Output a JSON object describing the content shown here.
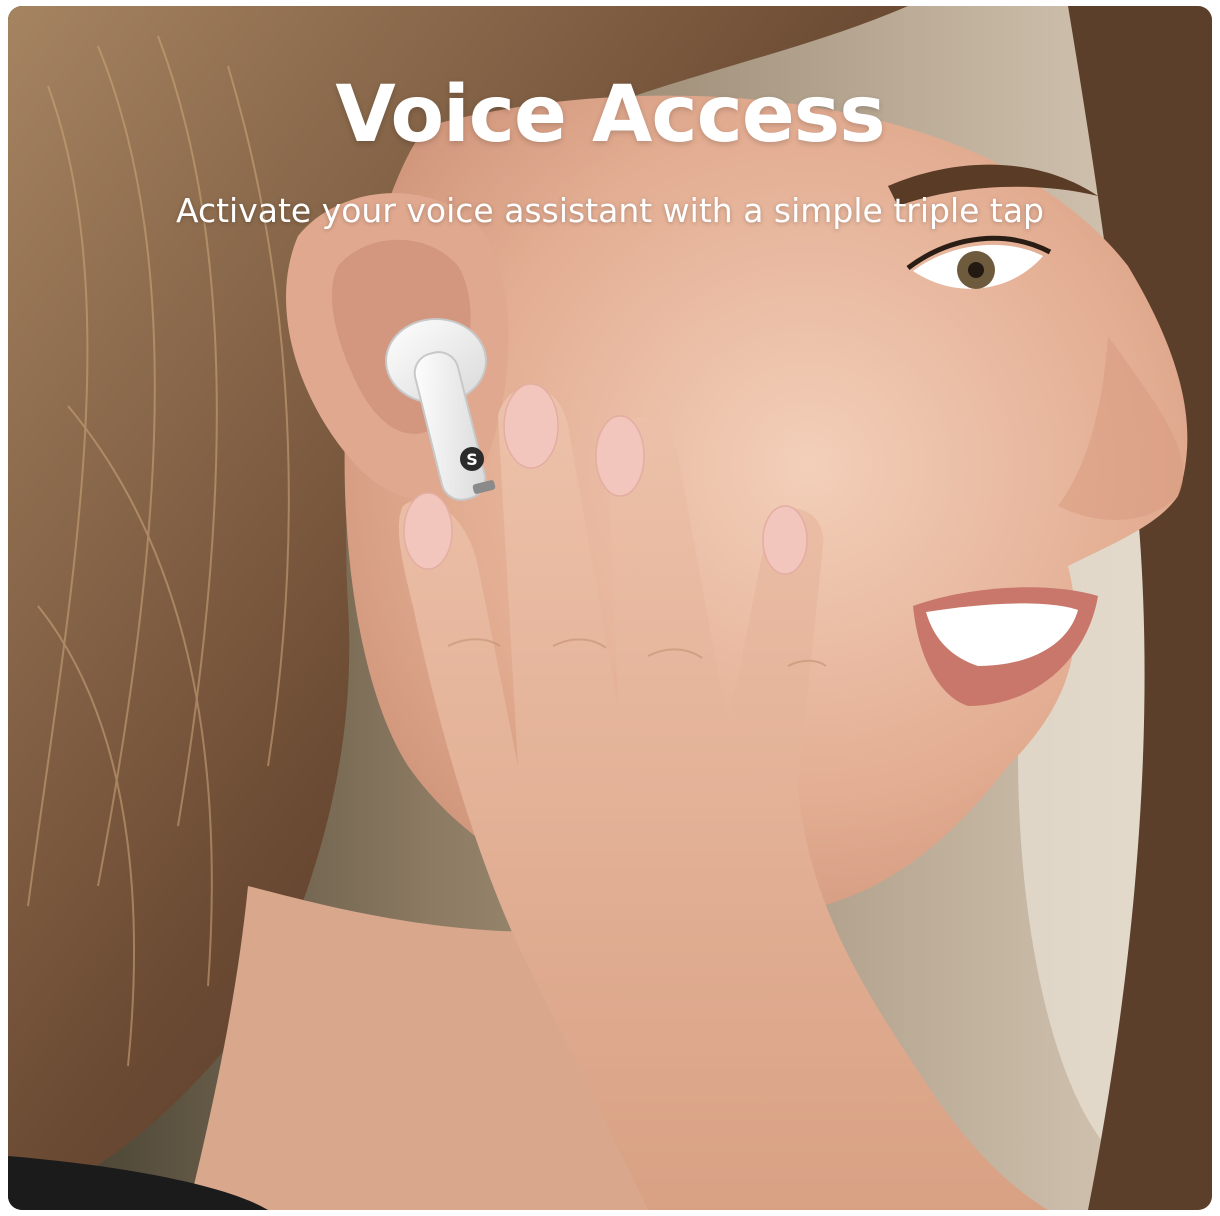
{
  "banner": {
    "title": "Voice Access",
    "subtitle": "Activate your voice assistant with a simple triple tap"
  },
  "photo": {
    "subject": "woman-with-earbud",
    "earbud_logo": "S",
    "colors": {
      "skin": "#e7b8a0",
      "hair": "#6b4a33",
      "earbud": "#f4f4f4",
      "nails": "#f2c6bd",
      "text": "#ffffff"
    }
  }
}
